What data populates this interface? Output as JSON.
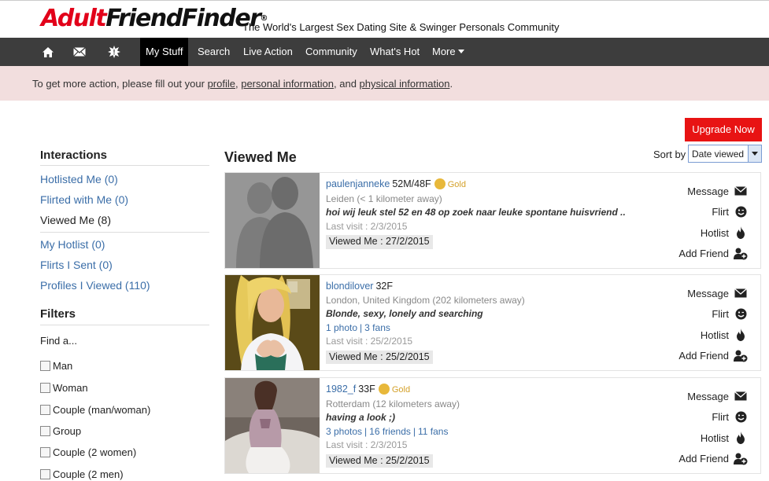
{
  "header": {
    "logo_red": "Adult",
    "logo_dark": "FriendFinder",
    "logo_reg": "®",
    "tagline": "The World's Largest Sex Dating Site & Swinger Personals Community"
  },
  "nav": {
    "items": [
      {
        "label": "My Stuff"
      },
      {
        "label": "Search"
      },
      {
        "label": "Live Action"
      },
      {
        "label": "Community"
      },
      {
        "label": "What's Hot"
      },
      {
        "label": "More"
      }
    ],
    "icons": [
      "home-icon",
      "mail-icon",
      "alert-icon"
    ]
  },
  "alert": {
    "prefix": "To get more action, please fill out your ",
    "link1": "profile",
    "sep1": ", ",
    "link2": "personal information",
    "sep2": ", and ",
    "link3": "physical information",
    "suffix": "."
  },
  "upgrade_label": "Upgrade Now",
  "sidebar": {
    "interactions_title": "Interactions",
    "links": [
      {
        "label": "Hotlisted Me (0)"
      },
      {
        "label": "Flirted with Me (0)"
      },
      {
        "label": "Viewed Me (8)"
      },
      {
        "label": "My Hotlist (0)"
      },
      {
        "label": "Flirts I Sent (0)"
      },
      {
        "label": "Profiles I Viewed (110)"
      }
    ],
    "filters_title": "Filters",
    "find_label": "Find a...",
    "filters": [
      {
        "label": "Man"
      },
      {
        "label": "Woman"
      },
      {
        "label": "Couple (man/woman)"
      },
      {
        "label": "Group"
      },
      {
        "label": "Couple (2 women)"
      },
      {
        "label": "Couple (2 men)"
      }
    ]
  },
  "main": {
    "title": "Viewed Me",
    "sort_label": "Sort by",
    "sort_value": "Date viewed"
  },
  "actions": {
    "message": "Message",
    "flirt": "Flirt",
    "hotlist": "Hotlist",
    "add_friend": "Add Friend"
  },
  "profiles": [
    {
      "username": "paulenjanneke",
      "demo": "52M/48F",
      "badge": "Gold",
      "location": "Leiden (< 1 kilometer away)",
      "headline": "hoi wij leuk stel 52 en 48 op zoek naar leuke spontane huisvriend ..",
      "last_visit": "Last visit : 2/3/2015",
      "viewed": "Viewed Me : 27/2/2015"
    },
    {
      "username": "blondilover",
      "demo": "32F",
      "location": "London, United Kingdom (202 kilometers away)",
      "headline": "Blonde, sexy, lonely and searching",
      "photos": "1 photo",
      "fans": "3 fans",
      "last_visit": "Last visit : 25/2/2015",
      "viewed": "Viewed Me : 25/2/2015"
    },
    {
      "username": "1982_f",
      "demo": "33F",
      "badge": "Gold",
      "location": "Rotterdam (12 kilometers away)",
      "headline": "having a look ;)",
      "photos": "3 photos",
      "friends": "16 friends",
      "fans": "11 fans",
      "last_visit": "Last visit : 2/3/2015",
      "viewed": "Viewed Me : 25/2/2015"
    }
  ]
}
